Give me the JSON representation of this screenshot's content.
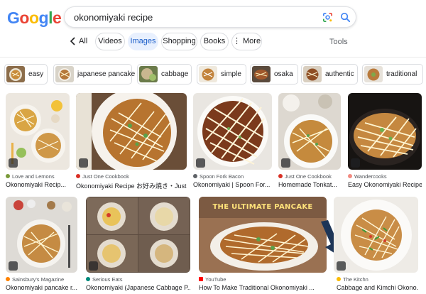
{
  "header": {
    "logo_letters": [
      {
        "ch": "G",
        "color": "#4285F4"
      },
      {
        "ch": "o",
        "color": "#EA4335"
      },
      {
        "ch": "o",
        "color": "#FBBC05"
      },
      {
        "ch": "g",
        "color": "#4285F4"
      },
      {
        "ch": "l",
        "color": "#34A853"
      },
      {
        "ch": "e",
        "color": "#EA4335"
      }
    ],
    "query": "okonomiyaki recipe",
    "icons": [
      "lens-icon",
      "search-icon"
    ]
  },
  "tabs": {
    "all": "All",
    "items": [
      "Videos",
      "Images",
      "Shopping",
      "Books",
      "More"
    ],
    "active": "Images",
    "more_icon": "⋮",
    "tools": "Tools"
  },
  "related": [
    "easy",
    "japanese pancake",
    "cabbage",
    "simple",
    "osaka",
    "authentic",
    "traditional"
  ],
  "results_row1": [
    {
      "source": "Love and Lemons",
      "title": "Okonomiyaki Recip...",
      "fav_color": "#7a9a3a"
    },
    {
      "source": "Just One Cookbook",
      "title": "Okonomiyaki Recipe お好み焼き・Just...",
      "fav_color": "#d93025"
    },
    {
      "source": "Spoon Fork Bacon",
      "title": "Okonomiyaki | Spoon For...",
      "fav_color": "#5f6368"
    },
    {
      "source": "Just One Cookbook",
      "title": "Homemade Tonkat...",
      "fav_color": "#d93025"
    },
    {
      "source": "Wandercooks",
      "title": "Easy Okonomiyaki Recipe",
      "fav_color": "#f28b82"
    }
  ],
  "results_row2": [
    {
      "source": "Sainsbury's Magazine",
      "title": "Okonomiyaki pancake r...",
      "fav_color": "#ff8200"
    },
    {
      "source": "Serious Eats",
      "title": "Okonomiyaki (Japanese Cabbage P...",
      "fav_color": "#00897b"
    },
    {
      "source": "YouTube",
      "title": "How To Make Traditional Okonomiyaki ...",
      "fav_color": "#ff0000",
      "overlay": "THE ULTIMATE PANCAKE"
    },
    {
      "source": "The Kitchn",
      "title": "Cabbage and Kimchi Okono...",
      "fav_color": "#fbbc05"
    }
  ],
  "colors": {
    "accent": "#1a73e8",
    "active_tab_bg": "#e8f0fe"
  }
}
